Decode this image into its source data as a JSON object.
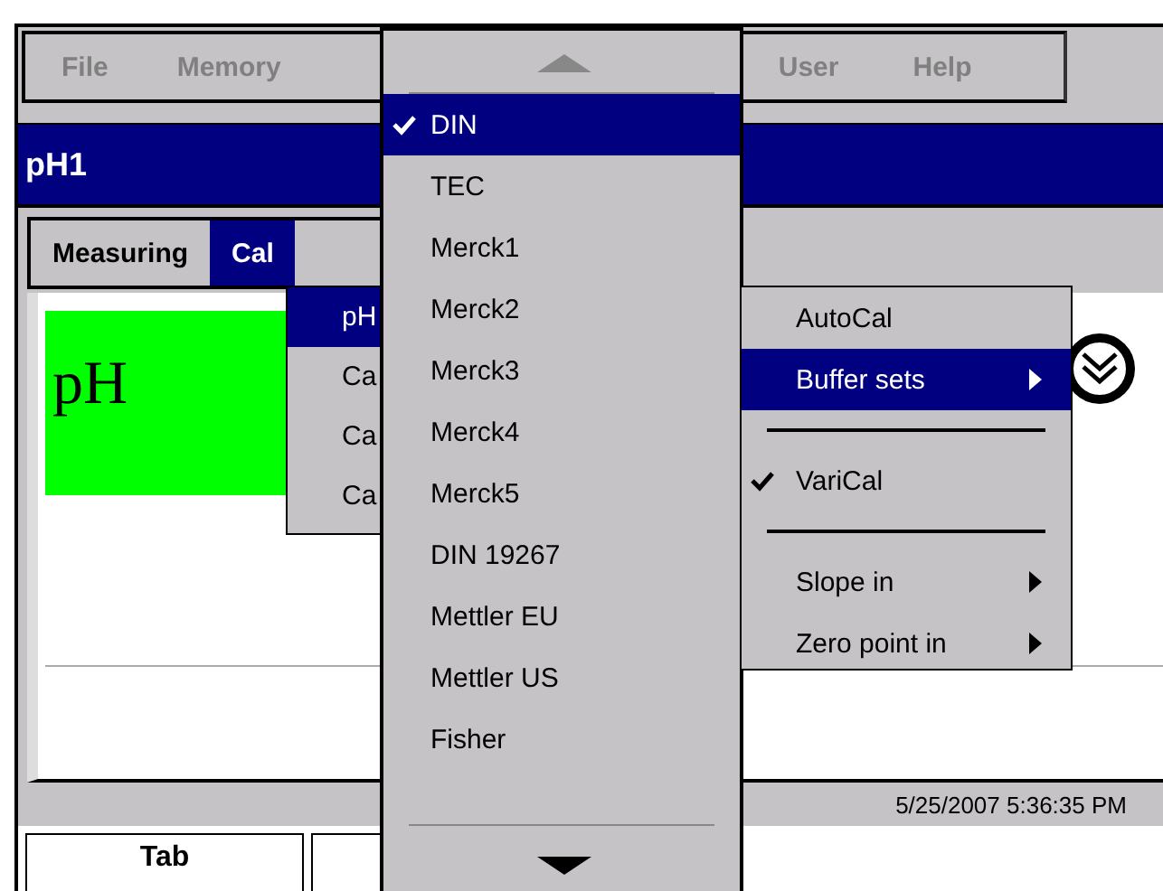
{
  "menu_bar": [
    {
      "label": "File"
    },
    {
      "label": "Memory"
    },
    {
      "label": "User"
    },
    {
      "label": "Help"
    }
  ],
  "title": "pH1",
  "tabs": [
    {
      "label": "Measuring",
      "selected": false
    },
    {
      "label": "Cal",
      "selected": true
    }
  ],
  "reading": {
    "unit": "pH"
  },
  "status_bar": {
    "datetime": "5/25/2007 5:36:35 PM"
  },
  "bottom_tabs": [
    {
      "label": "Tab"
    }
  ],
  "cal_menu": [
    {
      "label": "pH",
      "selected": true
    },
    {
      "label": "Ca",
      "selected": false
    },
    {
      "label": "Ca",
      "selected": false
    },
    {
      "label": "Ca",
      "selected": false
    }
  ],
  "buffer_menu": [
    {
      "label": "DIN",
      "selected": true,
      "checked": true
    },
    {
      "label": "TEC",
      "selected": false,
      "checked": false
    },
    {
      "label": "Merck1",
      "selected": false,
      "checked": false
    },
    {
      "label": "Merck2",
      "selected": false,
      "checked": false
    },
    {
      "label": "Merck3",
      "selected": false,
      "checked": false
    },
    {
      "label": "Merck4",
      "selected": false,
      "checked": false
    },
    {
      "label": "Merck5",
      "selected": false,
      "checked": false
    },
    {
      "label": "DIN 19267",
      "selected": false,
      "checked": false
    },
    {
      "label": "Mettler EU",
      "selected": false,
      "checked": false
    },
    {
      "label": "Mettler US",
      "selected": false,
      "checked": false
    },
    {
      "label": "Fisher",
      "selected": false,
      "checked": false
    }
  ],
  "cal_submenu": [
    {
      "kind": "item",
      "label": "AutoCal",
      "selected": false,
      "checked": false,
      "submenu": false
    },
    {
      "kind": "item",
      "label": "Buffer sets",
      "selected": true,
      "checked": false,
      "submenu": true
    },
    {
      "kind": "separator"
    },
    {
      "kind": "item",
      "label": "VariCal",
      "selected": false,
      "checked": true,
      "submenu": false
    },
    {
      "kind": "separator"
    },
    {
      "kind": "item",
      "label": "Slope in",
      "selected": false,
      "checked": false,
      "submenu": true
    },
    {
      "kind": "item",
      "label": "Zero point in",
      "selected": false,
      "checked": false,
      "submenu": true
    }
  ]
}
